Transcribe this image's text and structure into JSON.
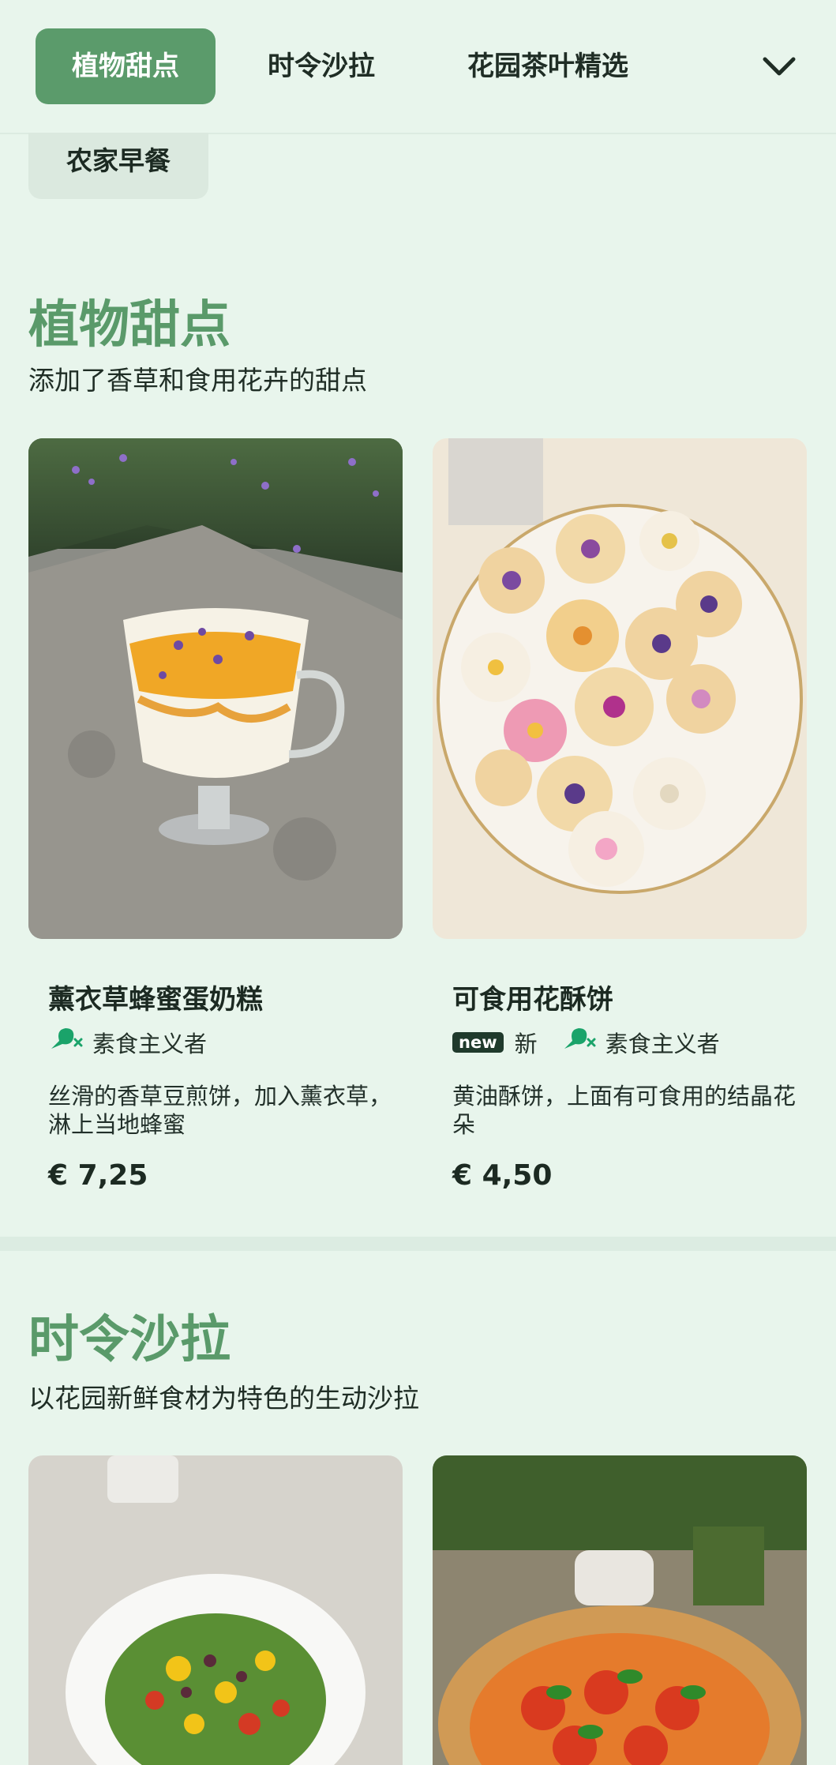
{
  "nav": {
    "tabs": [
      {
        "label": "植物甜点"
      },
      {
        "label": "时令沙拉"
      },
      {
        "label": "花园茶叶精选"
      },
      {
        "label": "农家早餐"
      }
    ],
    "accent_color": "#5b9b6b",
    "dropdown_icon": "chevron-down-icon"
  },
  "sections": [
    {
      "title": "植物甜点",
      "description": "添加了香草和食用花卉的甜点",
      "items": [
        {
          "name": "薰衣草蜂蜜蛋奶糕",
          "new_badge": "",
          "new_label": "",
          "diet_label": "素食主义者",
          "description": "丝滑的香草豆煎饼，加入薰衣草，淋上当地蜂蜜",
          "price": "€ 7,25"
        },
        {
          "name": "可食用花酥饼",
          "new_badge": "new",
          "new_label": "新",
          "diet_label": "素食主义者",
          "description": "黄油酥饼，上面有可食用的结晶花朵",
          "price": "€ 4,50"
        }
      ]
    },
    {
      "title": "时令沙拉",
      "description": "以花园新鲜食材为特色的生动沙拉"
    }
  ]
}
